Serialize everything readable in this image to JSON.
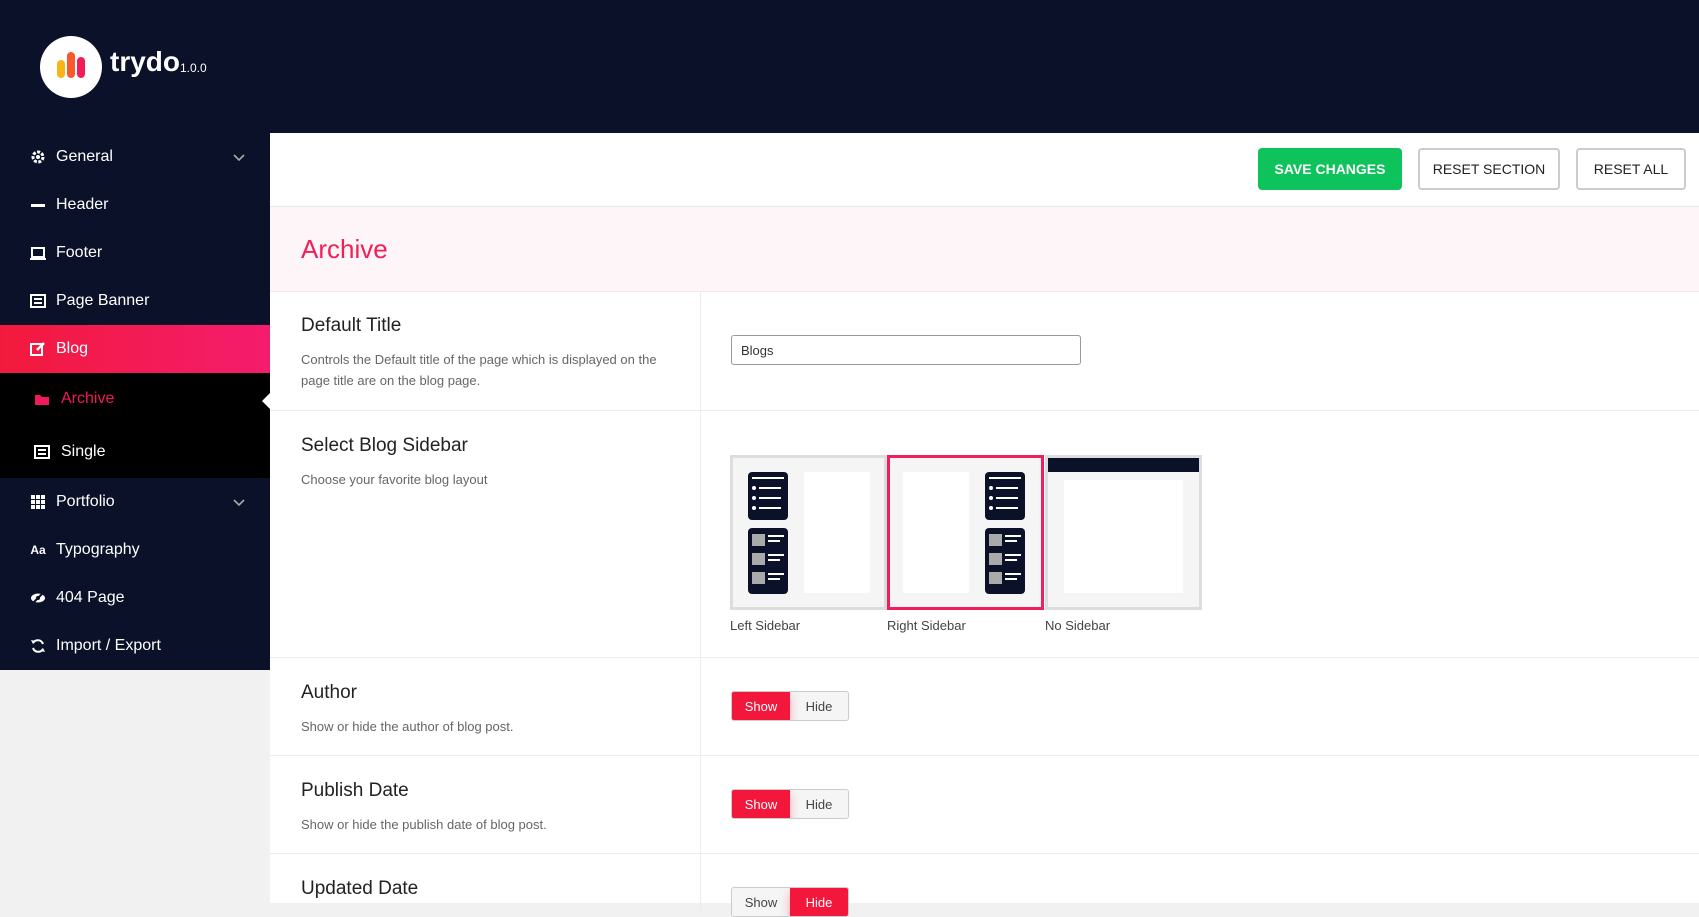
{
  "app": {
    "brand": "trydo",
    "version": "1.0.0"
  },
  "colors": {
    "accent": "#f01f5a",
    "save": "#0ec35b",
    "nav_bg": "#0a1128"
  },
  "nav": {
    "items": [
      {
        "label": "General",
        "icon": "gear-icon",
        "expandable": true
      },
      {
        "label": "Header",
        "icon": "minus-icon",
        "expandable": false
      },
      {
        "label": "Footer",
        "icon": "laptop-icon",
        "expandable": false
      },
      {
        "label": "Page Banner",
        "icon": "banner-icon",
        "expandable": false
      },
      {
        "label": "Blog",
        "icon": "edit-icon",
        "expandable": false,
        "active": true
      },
      {
        "label": "Portfolio",
        "icon": "grid-icon",
        "expandable": true
      },
      {
        "label": "Typography",
        "icon": "typography-icon",
        "expandable": false
      },
      {
        "label": "404 Page",
        "icon": "eye-slash-icon",
        "expandable": false
      },
      {
        "label": "Import / Export",
        "icon": "refresh-icon",
        "expandable": false
      }
    ],
    "blog_sub": [
      {
        "label": "Archive",
        "icon": "folder-icon",
        "current": true
      },
      {
        "label": "Single",
        "icon": "list-icon",
        "current": false
      }
    ]
  },
  "toolbar": {
    "save_label": "SAVE CHANGES",
    "reset_section_label": "RESET SECTION",
    "reset_all_label": "RESET ALL"
  },
  "section": {
    "title": "Archive"
  },
  "fields": {
    "default_title": {
      "title": "Default Title",
      "desc": "Controls the Default title of the page which is displayed on the page title are on the blog page.",
      "value": "Blogs"
    },
    "blog_sidebar": {
      "title": "Select Blog Sidebar",
      "desc": "Choose your favorite blog layout",
      "options": [
        "Left Sidebar",
        "Right Sidebar",
        "No Sidebar"
      ],
      "selected": "Right Sidebar"
    },
    "author": {
      "title": "Author",
      "desc": "Show or hide the author of blog post.",
      "show": "Show",
      "hide": "Hide",
      "value": "Show"
    },
    "publish_date": {
      "title": "Publish Date",
      "desc": "Show or hide the publish date of blog post.",
      "show": "Show",
      "hide": "Hide",
      "value": "Show"
    },
    "updated_date": {
      "title": "Updated Date",
      "show": "Show",
      "hide": "Hide",
      "value": "Hide"
    }
  }
}
